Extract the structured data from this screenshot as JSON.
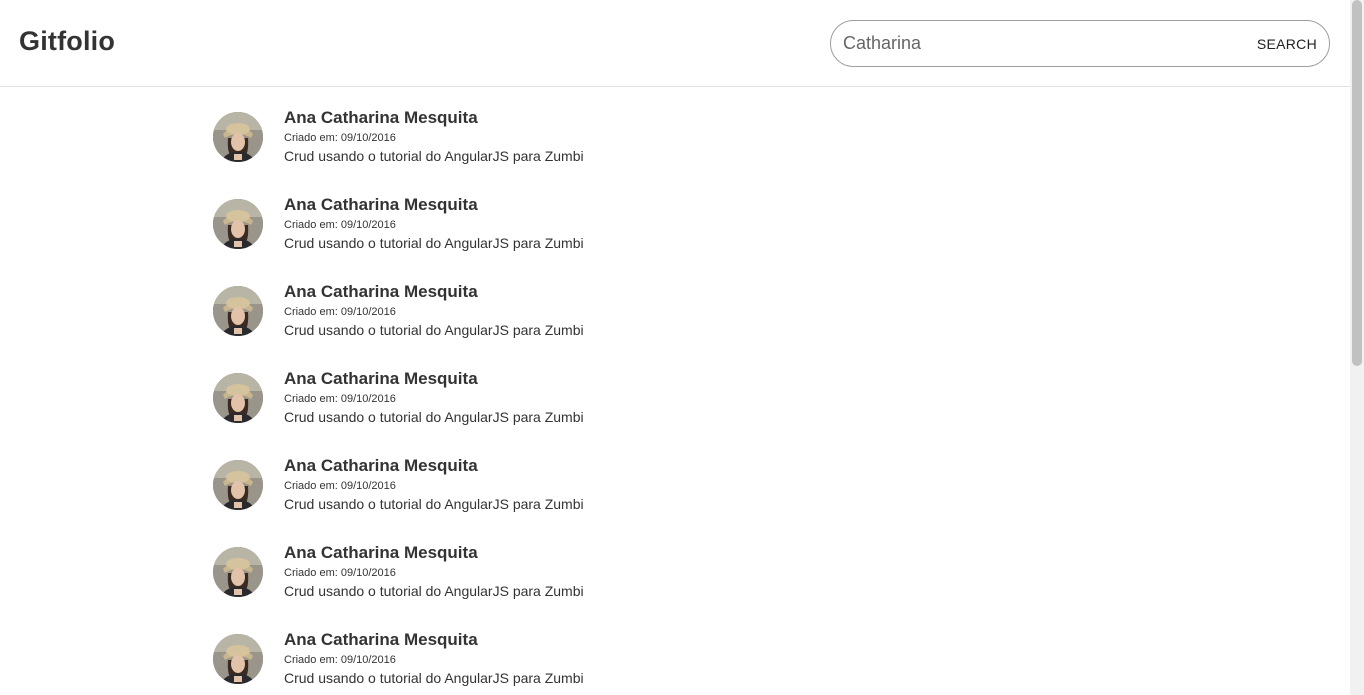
{
  "header": {
    "brand": "Gitfolio",
    "search": {
      "value": "Catharina",
      "button_label": "SEARCH"
    }
  },
  "results": [
    {
      "name": "Ana Catharina Mesquita",
      "created": "Criado em: 09/10/2016",
      "description": "Crud usando o tutorial do AngularJS para Zumbi"
    },
    {
      "name": "Ana Catharina Mesquita",
      "created": "Criado em: 09/10/2016",
      "description": "Crud usando o tutorial do AngularJS para Zumbi"
    },
    {
      "name": "Ana Catharina Mesquita",
      "created": "Criado em: 09/10/2016",
      "description": "Crud usando o tutorial do AngularJS para Zumbi"
    },
    {
      "name": "Ana Catharina Mesquita",
      "created": "Criado em: 09/10/2016",
      "description": "Crud usando o tutorial do AngularJS para Zumbi"
    },
    {
      "name": "Ana Catharina Mesquita",
      "created": "Criado em: 09/10/2016",
      "description": "Crud usando o tutorial do AngularJS para Zumbi"
    },
    {
      "name": "Ana Catharina Mesquita",
      "created": "Criado em: 09/10/2016",
      "description": "Crud usando o tutorial do AngularJS para Zumbi"
    },
    {
      "name": "Ana Catharina Mesquita",
      "created": "Criado em: 09/10/2016",
      "description": "Crud usando o tutorial do AngularJS para Zumbi"
    }
  ]
}
